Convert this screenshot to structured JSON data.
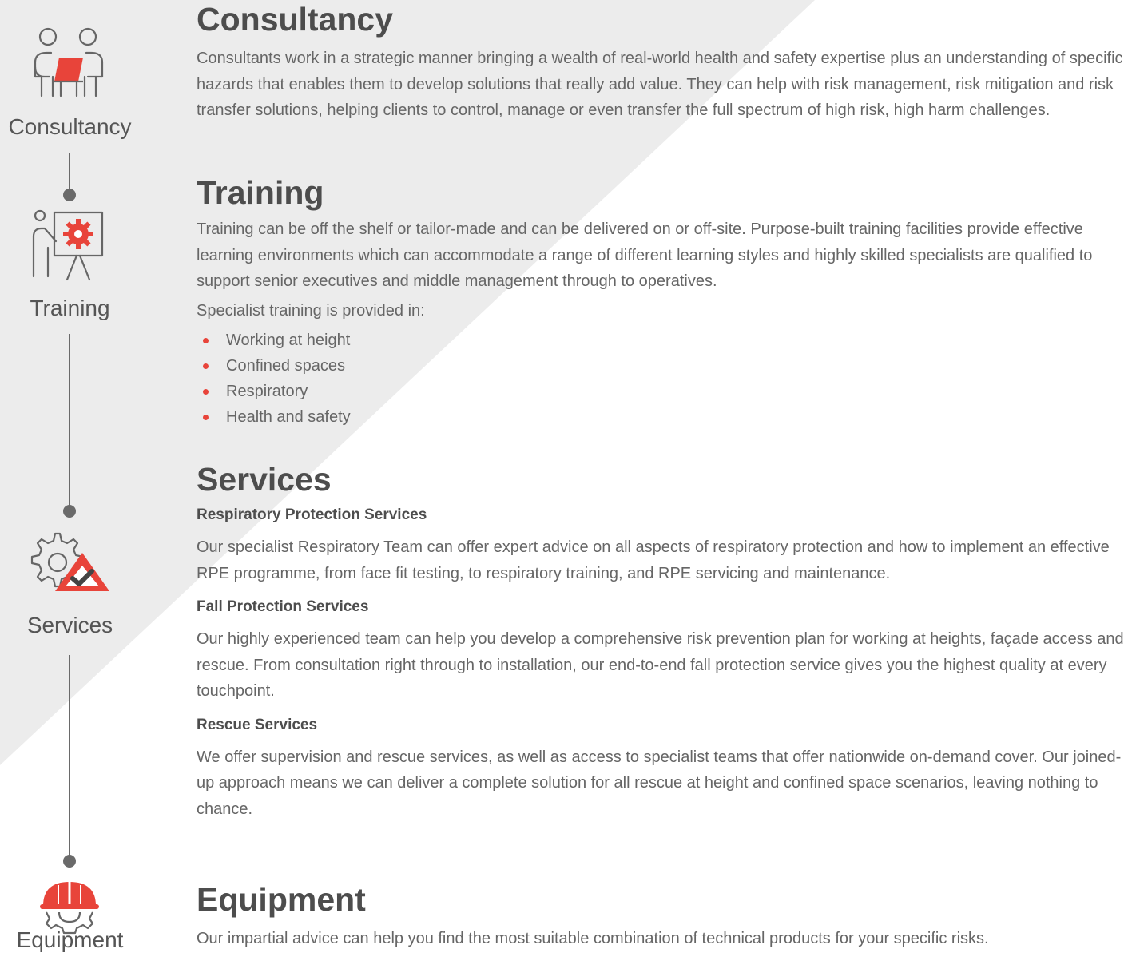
{
  "colors": {
    "accent": "#e8443a",
    "text": "#666666",
    "heading": "#4d4d4d",
    "line": "#6a6a6a",
    "background_band": "#ececec"
  },
  "timeline": {
    "items": [
      {
        "label": "Consultancy",
        "icon": "consultancy-people-icon"
      },
      {
        "label": "Training",
        "icon": "training-presentation-icon"
      },
      {
        "label": "Services",
        "icon": "services-gear-warning-icon"
      },
      {
        "label": "Equipment",
        "icon": "equipment-hardhat-gear-icon"
      }
    ]
  },
  "consultancy": {
    "title": "Consultancy",
    "body": "Consultants work in a strategic manner bringing a wealth of real-world health and safety expertise plus an understanding of specific hazards that enables them to develop solutions that really add value. They can help with risk management, risk mitigation and risk transfer solutions, helping clients to control, manage or even transfer the full spectrum of high risk, high harm challenges."
  },
  "training": {
    "title": "Training",
    "body": "Training can be off the shelf or tailor-made and can be delivered on or off-site. Purpose-built training facilities provide effective learning environments which can accommodate a range of different learning styles and highly skilled specialists are qualified to support senior executives and middle management through to operatives.",
    "intro": "Specialist training is provided in:",
    "list": [
      "Working at height",
      "Confined spaces",
      "Respiratory",
      "Health and safety"
    ]
  },
  "services": {
    "title": "Services",
    "items": [
      {
        "heading": "Respiratory Protection Services",
        "body": "Our specialist Respiratory Team can offer expert advice on all aspects of respiratory protection and how to implement an effective RPE programme, from face fit testing, to respiratory training, and RPE servicing and maintenance."
      },
      {
        "heading": "Fall Protection Services",
        "body": "Our highly experienced team can help you develop a comprehensive risk prevention plan for working at heights, façade access and rescue. From consultation right through to installation, our end-to-end fall protection service gives you the highest quality at every touchpoint."
      },
      {
        "heading": "Rescue Services",
        "body": "We offer supervision and rescue services, as well as access to specialist teams that offer nationwide on-demand cover. Our joined-up approach means we can deliver a complete solution for all rescue at height and confined space scenarios, leaving nothing to chance."
      }
    ]
  },
  "equipment": {
    "title": "Equipment",
    "body": "Our impartial advice can help you find the most suitable combination of technical products for your specific risks."
  }
}
